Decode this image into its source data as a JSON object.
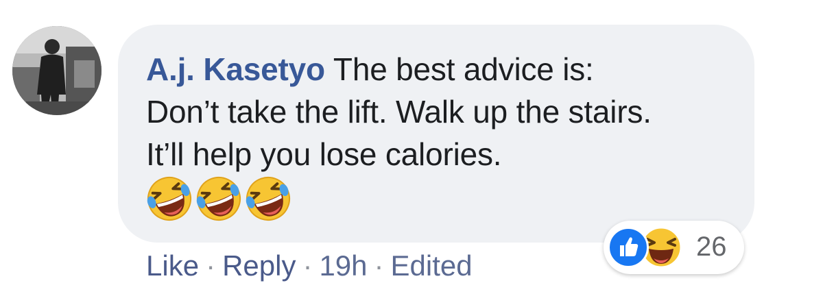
{
  "comment": {
    "author": "A.j. Kasetyo",
    "text_lines": [
      "The best advice is:",
      "Don’t take the lift. Walk up the stairs.",
      "It’ll help you lose calories."
    ],
    "emojis": [
      "rolling-on-floor-laughing-icon",
      "rolling-on-floor-laughing-icon",
      "rolling-on-floor-laughing-icon"
    ]
  },
  "reactions": {
    "icons": [
      "like-icon",
      "haha-icon"
    ],
    "count": "26"
  },
  "actions": {
    "like_label": "Like",
    "reply_label": "Reply",
    "separator": "·",
    "time": "19h",
    "edited": "Edited"
  },
  "colors": {
    "author": "#385898",
    "bubble": "#eff1f4",
    "like_blue": "#1877f2",
    "haha_yellow": "#f7c533"
  }
}
